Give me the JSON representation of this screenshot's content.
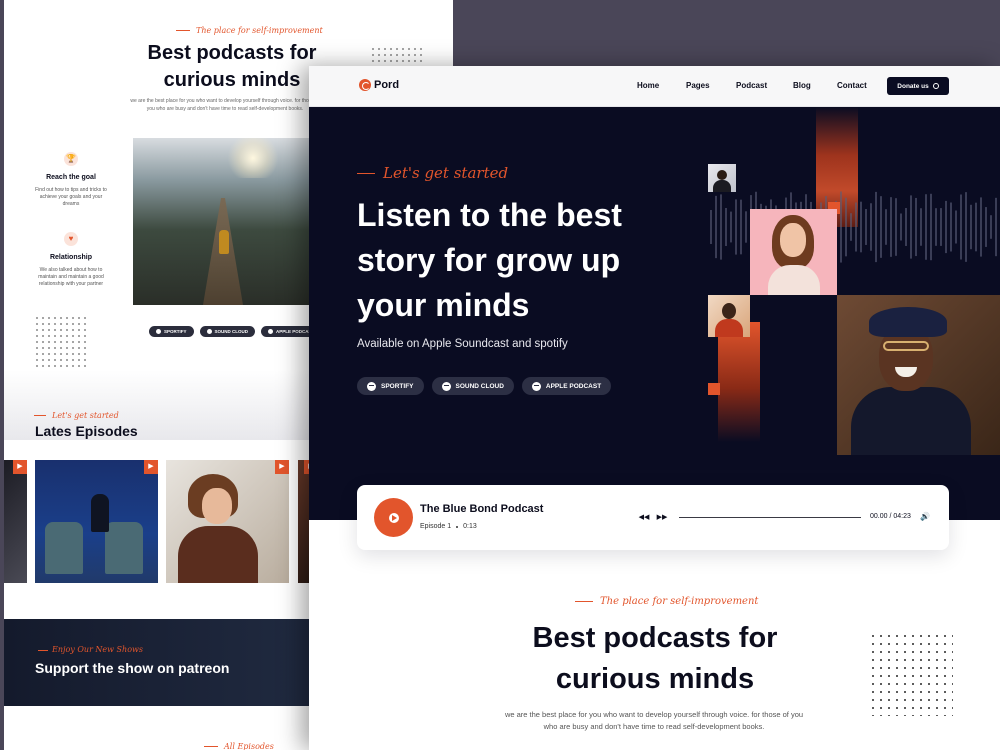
{
  "back_page": {
    "tagline": "The place for self-improvement",
    "title": "Best podcasts for curious minds",
    "description": "we are the best place for you who want to develop yourself through voice. for those of you who are busy and don't have time to read self-development books.",
    "features": [
      {
        "icon": "trophy-icon",
        "title": "Reach the goal",
        "text": "Find out how to tips and tricks to achieve your goals and your dreams"
      },
      {
        "icon": "heart-icon",
        "title": "Relationship",
        "text": "We also talked about how to maintain and maintain a good relationship with your partner"
      }
    ],
    "pills": [
      "SPORTIFY",
      "SOUND CLOUD",
      "APPLE PODCAST"
    ],
    "episodes_tagline": "Let's get started",
    "episodes_title": "Lates Episodes",
    "patreon_tagline": "Enjoy Our New Shows",
    "patreon_title": "Support the show on patreon",
    "all_episodes_tagline": "All Episodes"
  },
  "front_page": {
    "logo": "Pord",
    "nav": {
      "home": "Home",
      "pages": "Pages",
      "podcast": "Podcast",
      "blog": "Blog",
      "contact": "Contact",
      "donate": "Donate us"
    },
    "hero": {
      "tagline": "Let's get started",
      "title": "Listen to the best story for grow up your minds",
      "subtitle": "Available on Apple Soundcast and spotify",
      "pills": [
        "SPORTIFY",
        "SOUND CLOUD",
        "APPLE PODCAST"
      ]
    },
    "player": {
      "title": "The Blue Bond Podcast",
      "episode": "Episode 1",
      "duration": "0:13",
      "time": "00.00 / 04:23",
      "progress": 0
    },
    "section": {
      "tagline": "The place for self-improvement",
      "title": "Best podcasts for curious minds",
      "description": "we are the best place for you who want to develop yourself through voice. for those of you who are busy and don't have time to read self-development books."
    }
  },
  "colors": {
    "accent": "#e2552c",
    "hero_bg": "#0a0c22",
    "backdrop": "#4a4658",
    "pill_bg": "#2c2f44"
  }
}
